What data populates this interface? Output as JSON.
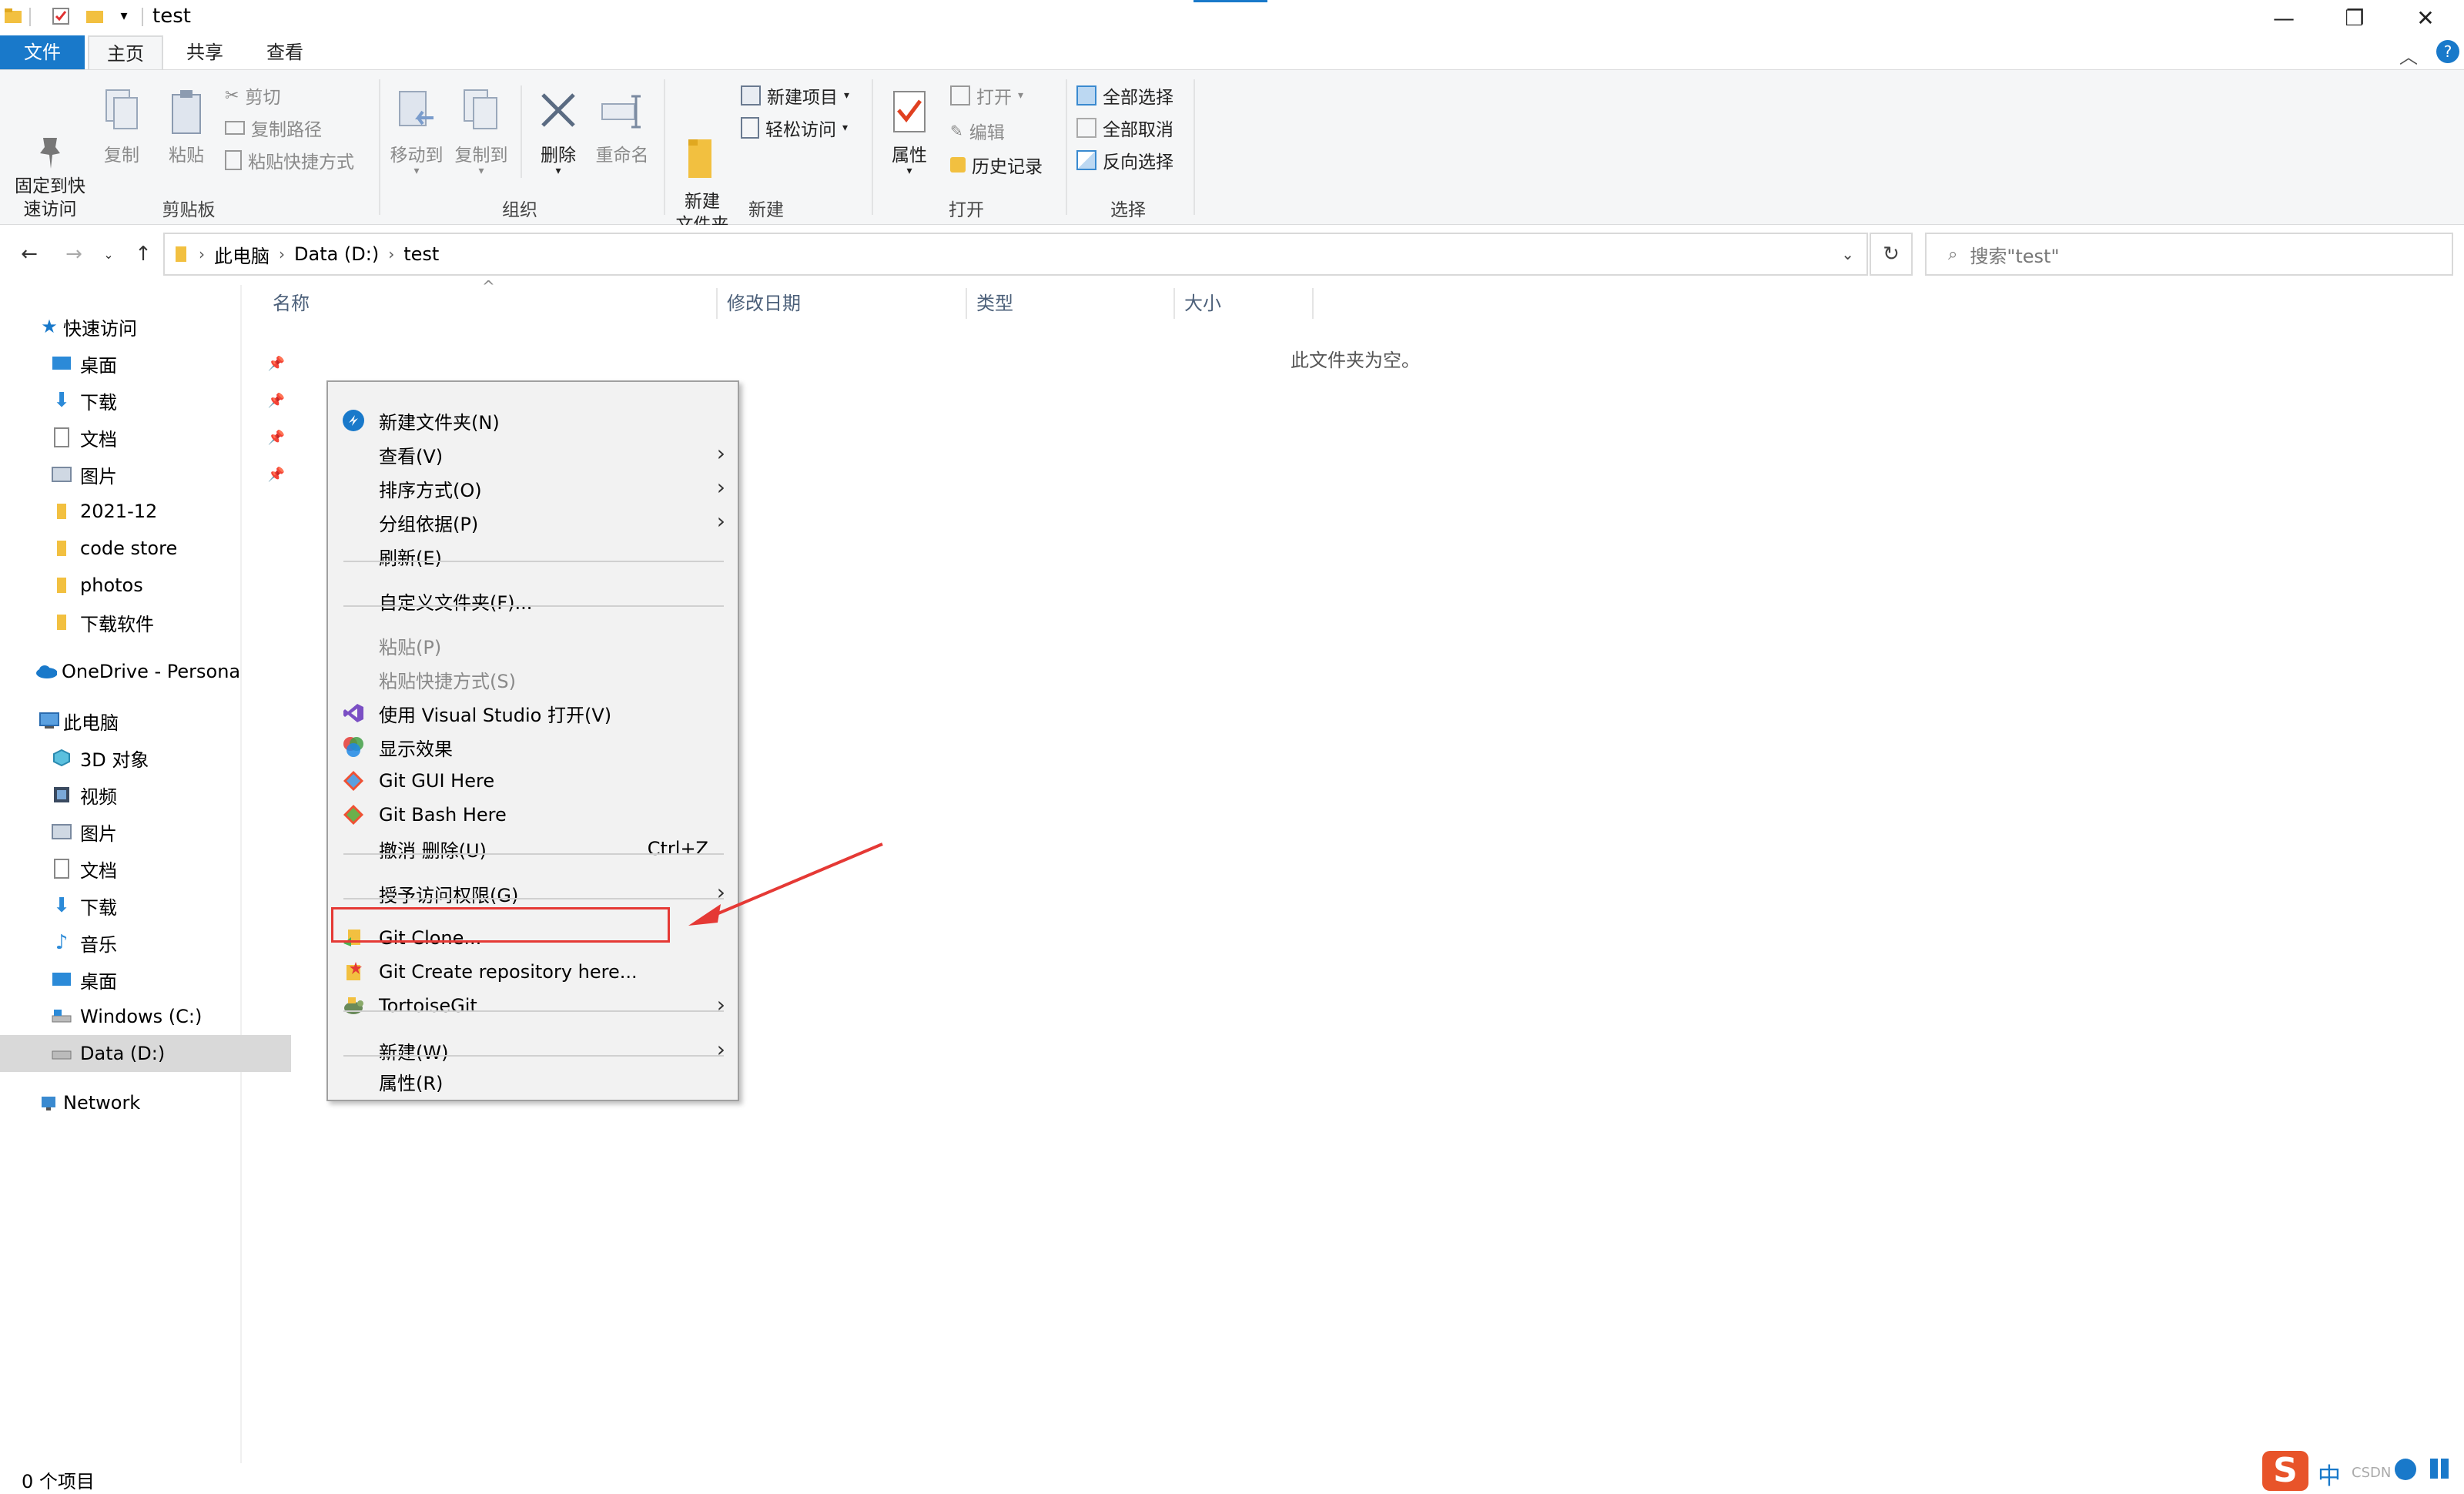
{
  "window": {
    "title": "test",
    "controls": [
      "—",
      "❐",
      "✕"
    ]
  },
  "ribbon_tabs": [
    {
      "label": "文件"
    },
    {
      "label": "主页"
    },
    {
      "label": "共享"
    },
    {
      "label": "查看"
    }
  ],
  "ribbon": {
    "clipboard": {
      "group": "剪贴板",
      "pin": "固定到快\n速访问",
      "copy": "复制",
      "paste": "粘贴",
      "cut": "剪切",
      "copy_path": "复制路径",
      "paste_shortcut": "粘贴快捷方式"
    },
    "organize": {
      "group": "组织",
      "move_to": "移动到",
      "copy_to": "复制到",
      "delete": "删除",
      "rename": "重命名"
    },
    "new": {
      "group": "新建",
      "new_folder": "新建\n文件夹",
      "new_item": "新建项目",
      "easy_access": "轻松访问"
    },
    "open": {
      "group": "打开",
      "properties": "属性",
      "open": "打开",
      "edit": "编辑",
      "history": "历史记录"
    },
    "select": {
      "group": "选择",
      "select_all": "全部选择",
      "select_none": "全部取消",
      "invert": "反向选择"
    }
  },
  "address": {
    "crumbs": [
      "此电脑",
      "Data (D:)",
      "test"
    ],
    "search_placeholder": "搜索\"test\""
  },
  "nav": {
    "quick_access": "快速访问",
    "quick_items": [
      {
        "label": "桌面",
        "pinned": true
      },
      {
        "label": "下载",
        "pinned": true
      },
      {
        "label": "文档",
        "pinned": true
      },
      {
        "label": "图片",
        "pinned": true
      },
      {
        "label": "2021-12"
      },
      {
        "label": "code store"
      },
      {
        "label": "photos"
      },
      {
        "label": "下载软件"
      }
    ],
    "onedrive": "OneDrive - Persona",
    "this_pc": "此电脑",
    "pc_items": [
      {
        "label": "3D 对象"
      },
      {
        "label": "视频"
      },
      {
        "label": "图片"
      },
      {
        "label": "文档"
      },
      {
        "label": "下载"
      },
      {
        "label": "音乐"
      },
      {
        "label": "桌面"
      },
      {
        "label": "Windows (C:)"
      },
      {
        "label": "Data (D:)"
      }
    ],
    "network": "Network"
  },
  "columns": [
    "名称",
    "修改日期",
    "类型",
    "大小"
  ],
  "empty_message": "此文件夹为空。",
  "status": "0 个项目",
  "context_menu": {
    "items": [
      {
        "label": "新建文件夹(N)"
      },
      {
        "label": "查看(V)"
      },
      {
        "label": "排序方式(O)"
      },
      {
        "label": "分组依据(P)"
      },
      {
        "label": "刷新(E)"
      },
      {
        "label": "自定义文件夹(F)..."
      },
      {
        "label": "粘贴(P)"
      },
      {
        "label": "粘贴快捷方式(S)"
      },
      {
        "label": "使用 Visual Studio 打开(V)"
      },
      {
        "label": "显示效果"
      },
      {
        "label": "Git GUI Here"
      },
      {
        "label": "Git Bash Here"
      },
      {
        "label": "撤消 删除(U)",
        "shortcut": "Ctrl+Z"
      },
      {
        "label": "授予访问权限(G)"
      },
      {
        "label": "Git Clone..."
      },
      {
        "label": "Git Create repository here..."
      },
      {
        "label": "TortoiseGit"
      },
      {
        "label": "新建(W)"
      },
      {
        "label": "属性(R)"
      }
    ]
  },
  "taskbar_tray": {
    "ime": "中",
    "watermark": "CSDN @"
  },
  "colors": {
    "file_tab": "#1979ca",
    "highlight": "#e53935",
    "folder": "#f2c040"
  }
}
